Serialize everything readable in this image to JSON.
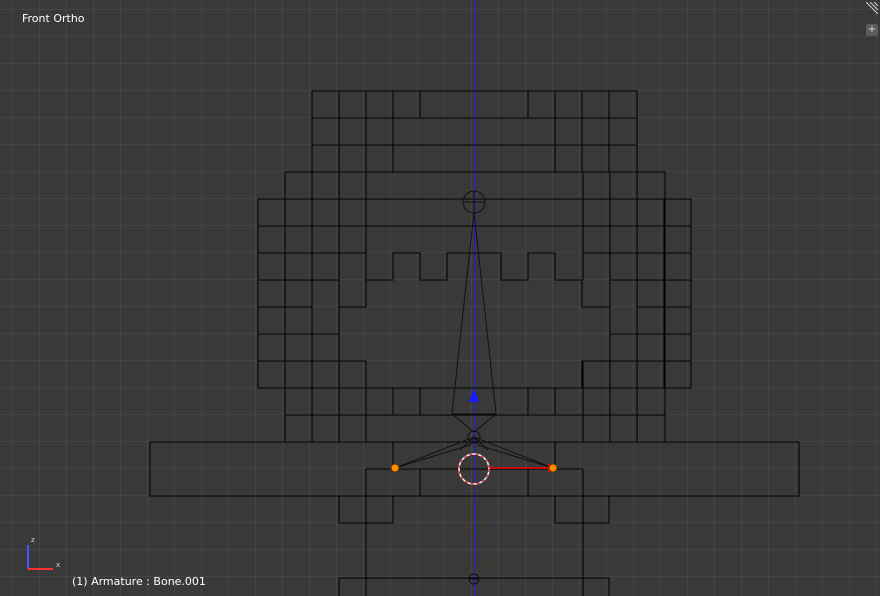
{
  "viewport": {
    "view_name": "Front Ortho",
    "status": "(1) Armature : Bone.001",
    "add_button": "+"
  },
  "axis_gizmo": {
    "z_label": "z",
    "x_label": "x",
    "z_color": "#3b5bff",
    "x_color": "#ff3030"
  },
  "colors": {
    "background": "#393939",
    "grid": "#444444",
    "wire": "#000000",
    "z_axis": "#1a1aff",
    "bone_outline": "#111111",
    "selected_bone": "#ff0000",
    "selected_joint": "#ff8c00",
    "cursor": "#ffffff"
  }
}
